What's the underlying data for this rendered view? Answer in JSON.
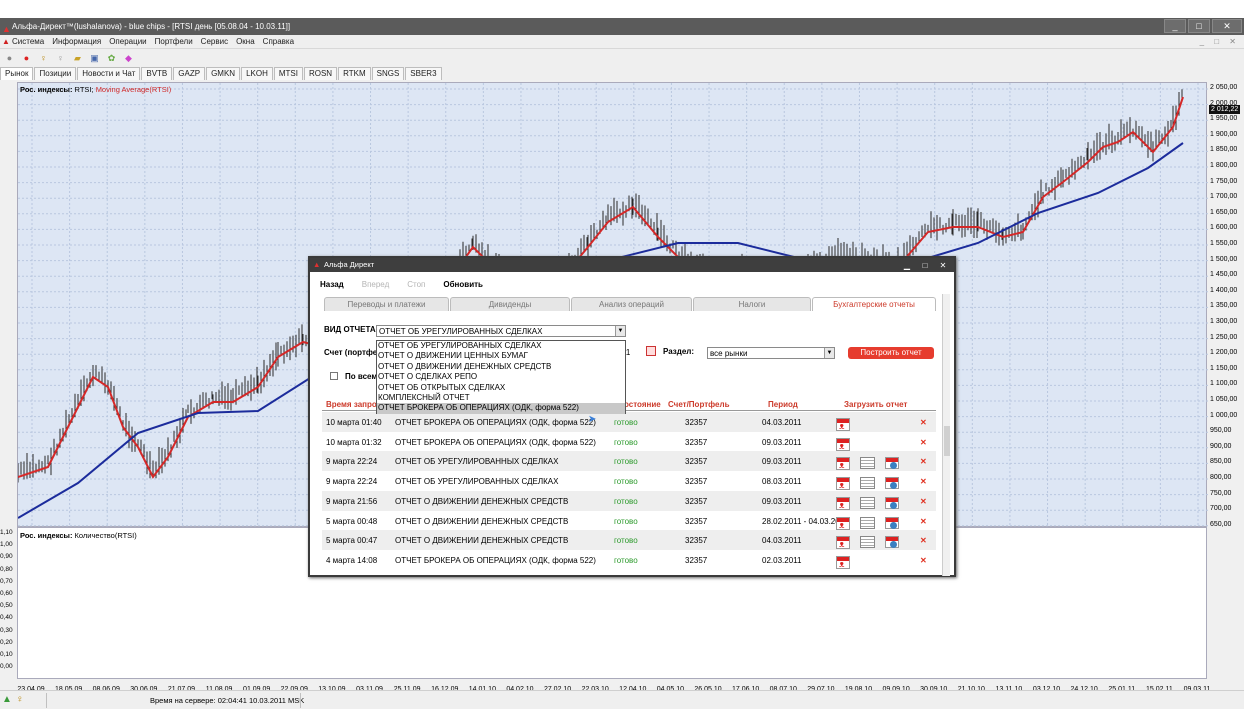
{
  "window": {
    "title": "Альфа-Директ™(lushalanova) - blue chips - [RTSI день [05.08.04 - 10.03.11]]",
    "controls": [
      "_",
      "□",
      "✕"
    ]
  },
  "menu": [
    "Система",
    "Информация",
    "Операции",
    "Портфели",
    "Сервис",
    "Окна",
    "Справка"
  ],
  "tabs": [
    "Рынок",
    "Позиции",
    "Новости и Чат",
    "BVTB",
    "GAZP",
    "GMKN",
    "LKOH",
    "MTSI",
    "ROSN",
    "RTKM",
    "SNGS",
    "SBER3"
  ],
  "main_chart": {
    "label_prefix": "Рос. индексы:",
    "label_symbol": "RTSI;",
    "label_ma": "Moving Average(RTSI)",
    "current_value": "2 012,22",
    "y_ticks": [
      "2 050,00",
      "2 000,00",
      "1 950,00",
      "1 900,00",
      "1 850,00",
      "1 800,00",
      "1 750,00",
      "1 700,00",
      "1 650,00",
      "1 600,00",
      "1 550,00",
      "1 500,00",
      "1 450,00",
      "1 400,00",
      "1 350,00",
      "1 300,00",
      "1 250,00",
      "1 200,00",
      "1 150,00",
      "1 100,00",
      "1 050,00",
      "1 000,00",
      "950,00",
      "900,00",
      "850,00",
      "800,00",
      "750,00",
      "700,00",
      "650,00"
    ],
    "colors": {
      "price": "#2a2a2a",
      "ma_red": "#d42828",
      "ma_blue": "#1c2c9c",
      "bg": "#dde6f4"
    }
  },
  "volume_chart": {
    "label_prefix": "Рос. индексы:",
    "label_series": "Количество(RTSI)",
    "y_ticks": [
      "1,10",
      "1,00",
      "0,90",
      "0,80",
      "0,70",
      "0,60",
      "0,50",
      "0,40",
      "0,30",
      "0,20",
      "0,10",
      "0,00"
    ]
  },
  "x_ticks": [
    "23.04.09",
    "18.05.09",
    "08.06.09",
    "30.06.09",
    "21.07.09",
    "11.08.09",
    "01.09.09",
    "22.09.09",
    "13.10.09",
    "03.11.09",
    "25.11.09",
    "16.12.09",
    "14.01.10",
    "04.02.10",
    "27.02.10",
    "22.03.10",
    "12.04.10",
    "04.05.10",
    "26.05.10",
    "17.06.10",
    "08.07.10",
    "29.07.10",
    "19.08.10",
    "09.09.10",
    "30.09.10",
    "21.10.10",
    "13.11.10",
    "03.12.10",
    "24.12.10",
    "25.01.11",
    "15.02.11",
    "09.03.11"
  ],
  "status": {
    "text": "Время на сервере: 02:04:41 10.03.2011 MSK"
  },
  "dialog": {
    "title": "Альфа Директ",
    "nav": {
      "back": "Назад",
      "forward": "Вперед",
      "stop": "Стоп",
      "refresh": "Обновить"
    },
    "tabs": [
      "Переводы и платежи",
      "Дивиденды",
      "Анализ операций",
      "Налоги",
      "Бухгалтерские отчеты"
    ],
    "report_type_label": "ВИД ОТЧЕТА:",
    "report_type_value": "ОТЧЕТ ОБ УРЕГУЛИРОВАННЫХ СДЕЛКАХ",
    "account_label": "Счет (портфе",
    "account_value": "11",
    "section_label": "Раздел:",
    "section_value": "все рынки",
    "build_button": "Построить отчет",
    "all_checkbox_label": "По всем",
    "dropdown_options": [
      "ОТЧЕТ ОБ УРЕГУЛИРОВАННЫХ СДЕЛКАХ",
      "ОТЧЕТ О ДВИЖЕНИИ ЦЕННЫХ БУМАГ",
      "ОТЧЕТ О ДВИЖЕНИИ ДЕНЕЖНЫХ СРЕДСТВ",
      "ОТЧЕТ О СДЕЛКАХ РЕПО",
      "ОТЧЕТ ОБ ОТКРЫТЫХ СДЕЛКАХ",
      "КОМПЛЕКСНЫЙ ОТЧЕТ",
      "ОТЧЕТ БРОКЕРА ОБ ОПЕРАЦИЯХ (ОДК, форма 522)"
    ],
    "columns": {
      "time": "Время запрос",
      "state": "остояние",
      "account": "Счет/Портфель",
      "period": "Период",
      "download": "Загрузить отчет"
    },
    "rows": [
      {
        "time": "10 марта 01:40",
        "report": "ОТЧЕТ БРОКЕРА ОБ ОПЕРАЦИЯХ (ОДК, форма 522)",
        "state": "готово",
        "account": "32357",
        "period": "04.03.2011",
        "formats": [
          "pdf"
        ]
      },
      {
        "time": "10 марта 01:32",
        "report": "ОТЧЕТ БРОКЕРА ОБ ОПЕРАЦИЯХ (ОДК, форма 522)",
        "state": "готово",
        "account": "32357",
        "period": "09.03.2011",
        "formats": [
          "pdf"
        ]
      },
      {
        "time": "9 марта 22:24",
        "report": "ОТЧЕТ ОБ УРЕГУЛИРОВАННЫХ СДЕЛКАХ",
        "state": "готово",
        "account": "32357",
        "period": "09.03.2011",
        "formats": [
          "pdf",
          "doc",
          "web"
        ]
      },
      {
        "time": "9 марта 22:24",
        "report": "ОТЧЕТ ОБ УРЕГУЛИРОВАННЫХ СДЕЛКАХ",
        "state": "готово",
        "account": "32357",
        "period": "08.03.2011",
        "formats": [
          "pdf",
          "doc",
          "web"
        ]
      },
      {
        "time": "9 марта 21:56",
        "report": "ОТЧЕТ О ДВИЖЕНИИ ДЕНЕЖНЫХ СРЕДСТВ",
        "state": "готово",
        "account": "32357",
        "period": "09.03.2011",
        "formats": [
          "pdf",
          "doc",
          "web"
        ]
      },
      {
        "time": "5 марта 00:48",
        "report": "ОТЧЕТ О ДВИЖЕНИИ ДЕНЕЖНЫХ СРЕДСТВ",
        "state": "готово",
        "account": "32357",
        "period": "28.02.2011 - 04.03.2011",
        "formats": [
          "pdf",
          "doc",
          "web"
        ]
      },
      {
        "time": "5 марта 00:47",
        "report": "ОТЧЕТ О ДВИЖЕНИИ ДЕНЕЖНЫХ СРЕДСТВ",
        "state": "готово",
        "account": "32357",
        "period": "04.03.2011",
        "formats": [
          "pdf",
          "doc",
          "web"
        ]
      },
      {
        "time": "4 марта 14:08",
        "report": "ОТЧЕТ БРОКЕРА ОБ ОПЕРАЦИЯХ (ОДК, форма 522)",
        "state": "готово",
        "account": "32357",
        "period": "02.03.2011",
        "formats": [
          "pdf"
        ]
      }
    ]
  }
}
